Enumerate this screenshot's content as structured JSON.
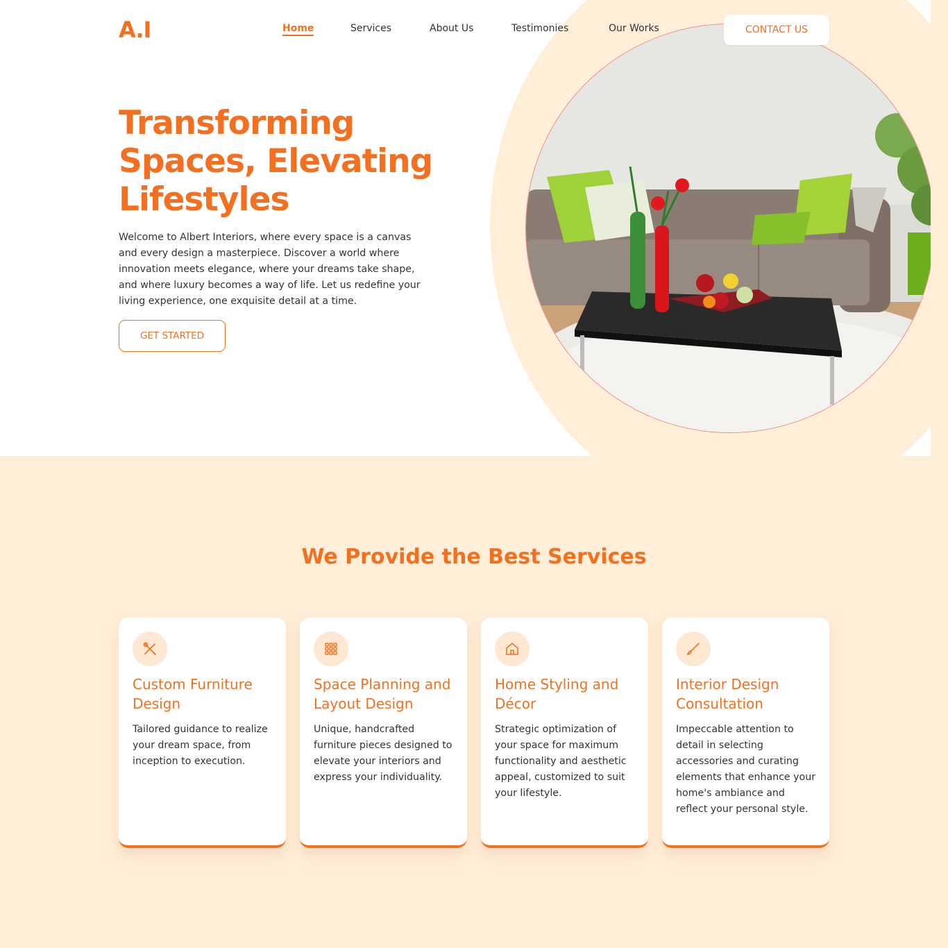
{
  "header": {
    "logo": "A.I",
    "nav": [
      "Home",
      "Services",
      "About Us",
      "Testimonies",
      "Our Works"
    ],
    "active_nav": "Home",
    "contact_label": "CONTACT US"
  },
  "hero": {
    "title": "Transforming Spaces, Elevating Lifestyles",
    "text": "Welcome to Albert Interiors, where every space is a canvas and every design a masterpiece. Discover a world where innovation meets elegance, where your dreams take shape, and where luxury becomes a way of life. Let us redefine your living experience, one exquisite detail at a time.",
    "cta_label": "GET STARTED"
  },
  "services": {
    "title": "We Provide the Best Services",
    "cards": [
      {
        "icon": "tools-icon",
        "title": "Custom Furniture Design",
        "text": "Tailored guidance to realize your dream space, from inception to execution."
      },
      {
        "icon": "grid-icon",
        "title": "Space Planning and Layout Design",
        "text": "Unique, handcrafted furniture pieces designed to elevate your interiors and express your individuality."
      },
      {
        "icon": "home-icon",
        "title": "Home Styling and Décor",
        "text": "Strategic optimization of your space for maximum functionality and aesthetic appeal, customized to suit your lifestyle."
      },
      {
        "icon": "brush-icon",
        "title": "Interior Design Consultation",
        "text": "Impeccable attention to detail in selecting accessories and curating elements that enhance your home's ambiance and reflect your personal style."
      }
    ]
  },
  "colors": {
    "accent": "#f37021",
    "cream": "#ffeed8",
    "icon_bg": "#ffe8d3"
  }
}
